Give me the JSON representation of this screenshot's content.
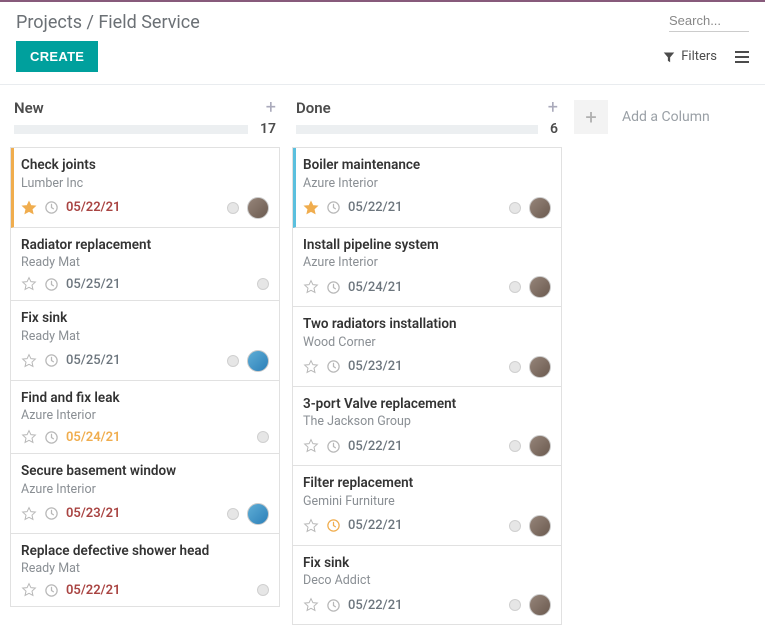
{
  "breadcrumb": {
    "parent": "Projects",
    "sep": " / ",
    "current": "Field Service"
  },
  "search": {
    "placeholder": "Search..."
  },
  "toolbar": {
    "create": "CREATE",
    "filters": "Filters"
  },
  "add_column": "Add a Column",
  "columns": [
    {
      "title": "New",
      "count": "17",
      "cards": [
        {
          "title": "Check joints",
          "subtitle": "Lumber Inc",
          "date": "05/22/21",
          "date_class": "red",
          "starred": true,
          "clock": "gray",
          "avatar": "main",
          "accent": "orange"
        },
        {
          "title": "Radiator replacement",
          "subtitle": "Ready Mat",
          "date": "05/25/21",
          "date_class": "gray",
          "starred": false,
          "clock": "gray",
          "avatar": "none",
          "accent": ""
        },
        {
          "title": "Fix sink",
          "subtitle": "Ready Mat",
          "date": "05/25/21",
          "date_class": "gray",
          "starred": false,
          "clock": "gray",
          "avatar": "alt",
          "accent": ""
        },
        {
          "title": "Find and fix leak",
          "subtitle": "Azure Interior",
          "date": "05/24/21",
          "date_class": "orange",
          "starred": false,
          "clock": "gray",
          "avatar": "none",
          "accent": ""
        },
        {
          "title": "Secure basement window",
          "subtitle": "Azure Interior",
          "date": "05/23/21",
          "date_class": "red",
          "starred": false,
          "clock": "gray",
          "avatar": "alt",
          "accent": ""
        },
        {
          "title": "Replace defective shower head",
          "subtitle": "Ready Mat",
          "date": "05/22/21",
          "date_class": "red",
          "starred": false,
          "clock": "gray",
          "avatar": "none",
          "accent": ""
        }
      ]
    },
    {
      "title": "Done",
      "count": "6",
      "cards": [
        {
          "title": "Boiler maintenance",
          "subtitle": "Azure Interior",
          "date": "05/22/21",
          "date_class": "gray",
          "starred": true,
          "clock": "gray",
          "avatar": "main",
          "accent": "blue"
        },
        {
          "title": "Install pipeline system",
          "subtitle": "Azure Interior",
          "date": "05/24/21",
          "date_class": "gray",
          "starred": false,
          "clock": "gray",
          "avatar": "main",
          "accent": ""
        },
        {
          "title": "Two radiators installation",
          "subtitle": "Wood Corner",
          "date": "05/23/21",
          "date_class": "gray",
          "starred": false,
          "clock": "gray",
          "avatar": "main",
          "accent": ""
        },
        {
          "title": "3-port Valve replacement",
          "subtitle": "The Jackson Group",
          "date": "05/22/21",
          "date_class": "gray",
          "starred": false,
          "clock": "gray",
          "avatar": "main",
          "accent": ""
        },
        {
          "title": "Filter replacement",
          "subtitle": "Gemini Furniture",
          "date": "05/22/21",
          "date_class": "gray",
          "starred": false,
          "clock": "orange",
          "avatar": "main",
          "accent": ""
        },
        {
          "title": "Fix sink",
          "subtitle": "Deco Addict",
          "date": "05/22/21",
          "date_class": "gray",
          "starred": false,
          "clock": "gray",
          "avatar": "main",
          "accent": ""
        }
      ]
    }
  ]
}
